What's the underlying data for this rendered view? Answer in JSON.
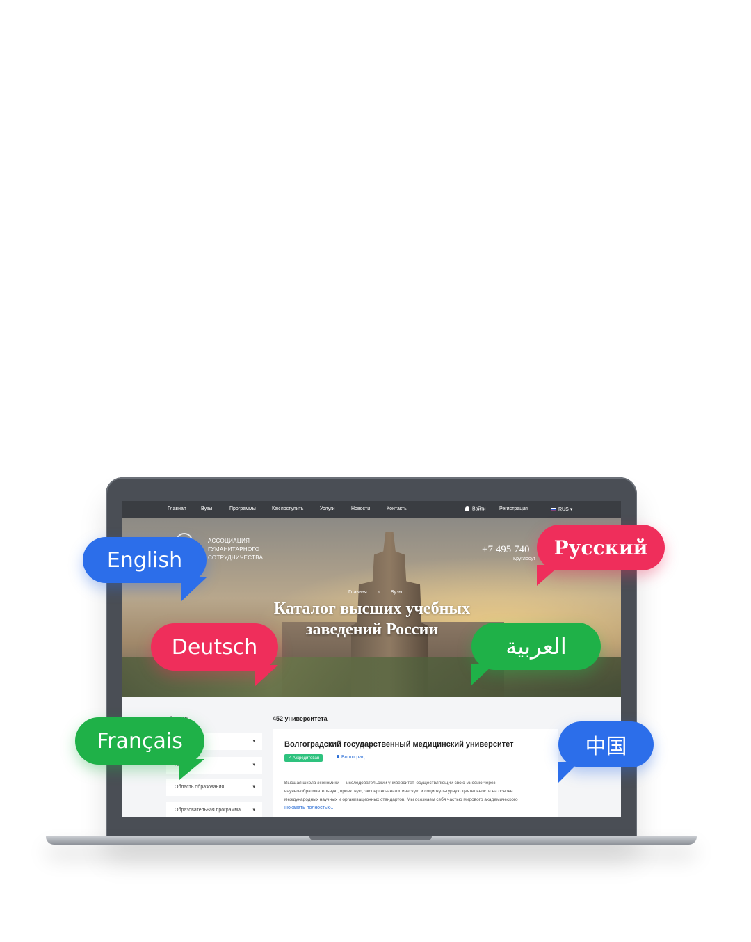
{
  "nav": {
    "items": [
      "Главная",
      "Вузы",
      "Программы",
      "Как поступить",
      "Услуги",
      "Новости",
      "Контакты"
    ],
    "login": "Войти",
    "register": "Регистрация",
    "language": "RUS ▾"
  },
  "hero": {
    "logo_lines": [
      "АССОЦИАЦИЯ",
      "ГУМАНИТАРНОГО",
      "СОТРУДНИЧЕСТВА"
    ],
    "phone": "+7 495 740",
    "phone_sub": "Круглосут",
    "breadcrumbs": [
      "Главная",
      "Вузы"
    ],
    "title_line1": "Каталог высших учебных",
    "title_line2": "заведений России"
  },
  "content": {
    "filters_title": "Фильтр",
    "filters": [
      "",
      "Город",
      "Область образования",
      "Образовательная программа"
    ],
    "count": "452 университета",
    "card": {
      "title": "Волгоградский государственный медицинский университет",
      "badge": "✓ Аккредитован",
      "city": "Волгоград",
      "desc_lines": [
        "Высшая школа экономики — исследовательский университет, осуществляющий свою миссию через",
        "научно-образовательную, проектную, экспертно-аналитическую и социокультурную деятельности на основе",
        "международных научных и организационных стандартов. Мы осознаем себя частью мирового академического"
      ],
      "more": "Показать полностью..."
    }
  },
  "bubbles": {
    "english": "English",
    "russian": "Русский",
    "deutsch": "Deutsch",
    "arabic": "العربية",
    "francais": "Français",
    "chinese": "中国"
  },
  "colors": {
    "blue": "#2c6eea",
    "red": "#ef2e5b",
    "green": "#1fb148"
  }
}
